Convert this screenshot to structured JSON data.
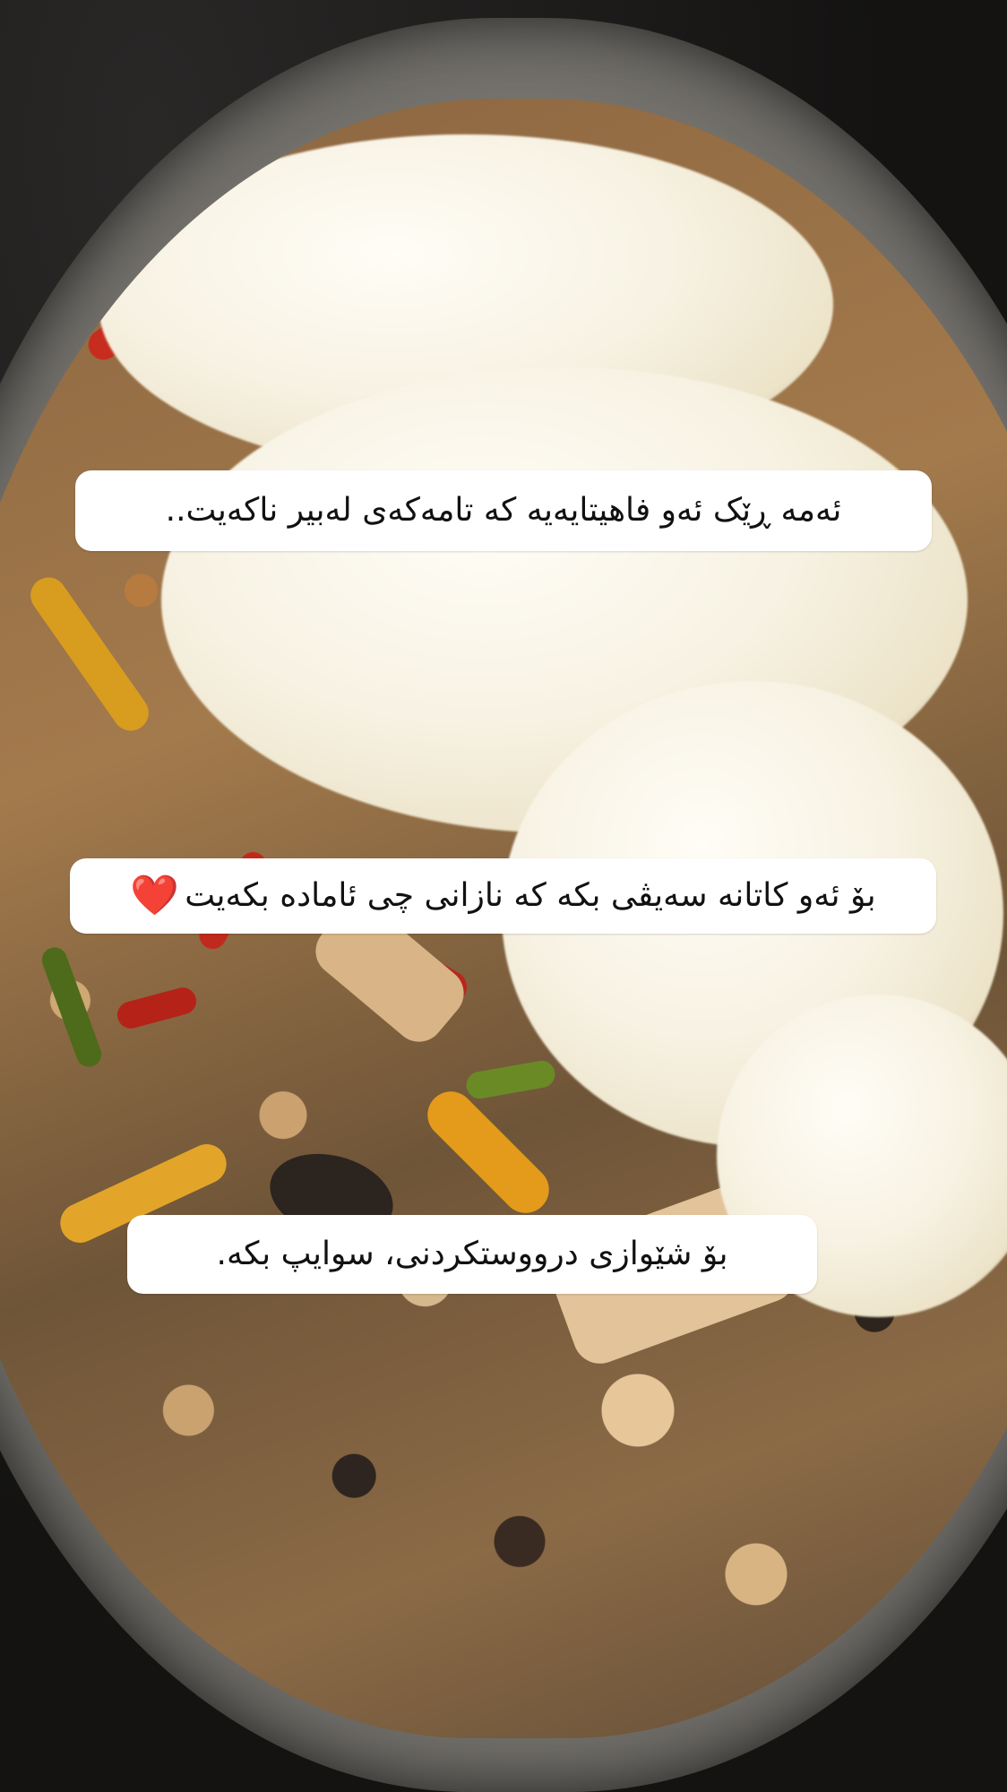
{
  "captions": {
    "line1": "ئەمە ڕێک ئەو فاهیتایەیە کە تامەکەی لەبیر ناکەیت..",
    "line2": "بۆ ئەو کاتانە سەیڤی بکە کە نازانی چی ئامادە بکەیت",
    "line2_emoji": "❤️",
    "line3": "بۆ شێوازی درووستکردنی، سوایپ بکە."
  },
  "photo": {
    "subject": "chicken fajita skillet with melted cheese",
    "colors": {
      "cheese": "#f7f2e3",
      "red_pepper": "#c8281e",
      "yellow_pepper": "#e8a21c",
      "green_pepper": "#5c7a1e",
      "chicken": "#d6b88d",
      "pan": "#8a8782"
    }
  }
}
